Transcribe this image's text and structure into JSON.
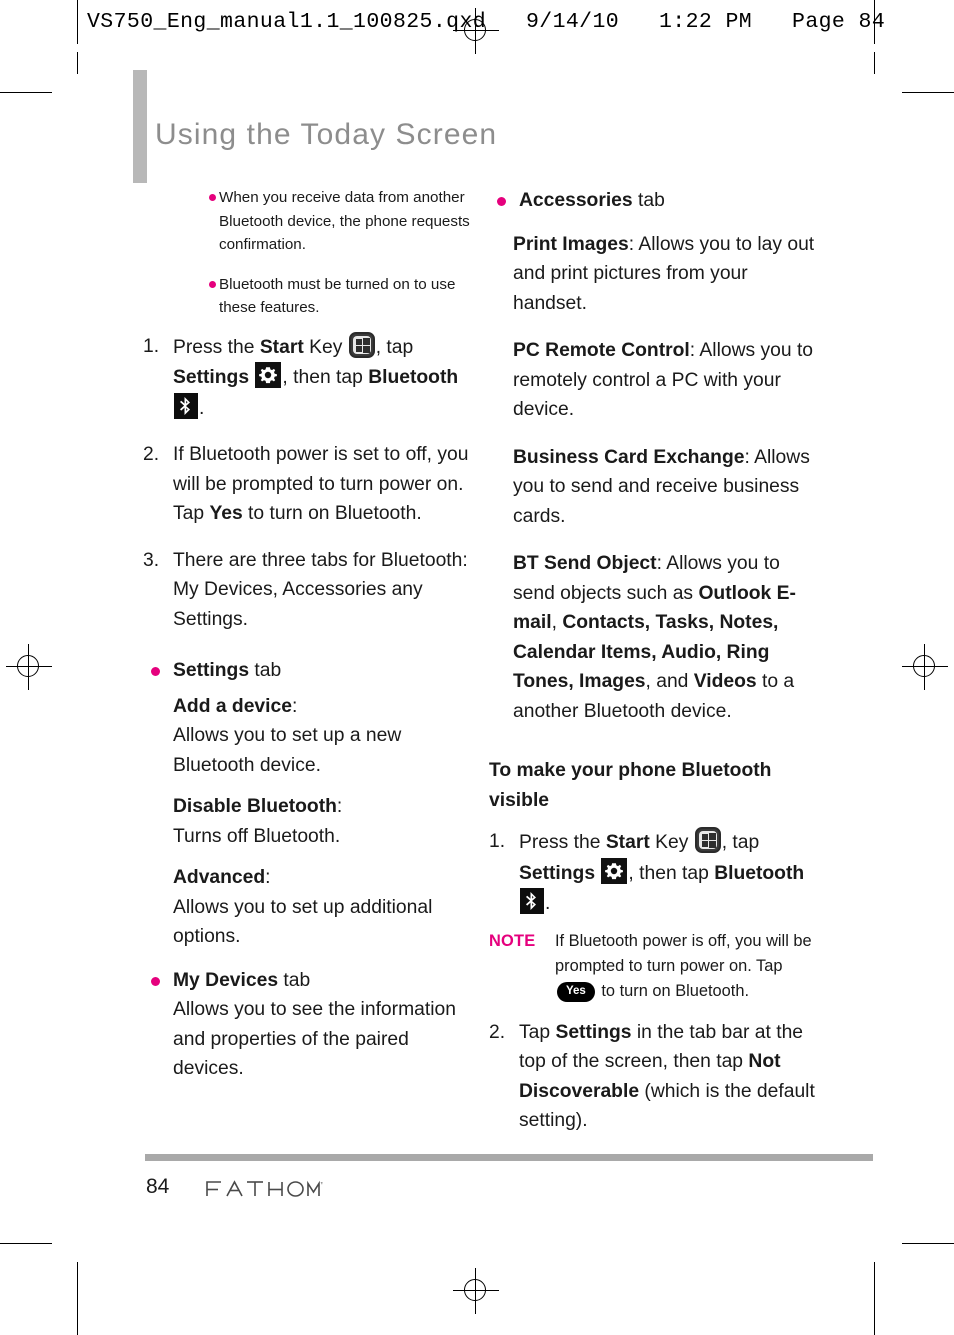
{
  "file_header": "VS750_Eng_manual1.1_100825.qxd   9/14/10   1:22 PM   Page 84",
  "page_title": "Using the Today Screen",
  "colors": {
    "accent_magenta": "#e5007d",
    "title_gray": "#8d8d8d",
    "rule_gray": "#a9a9a9"
  },
  "left_column": {
    "notes": [
      "When you receive data from another Bluetooth device, the phone requests confirmation.",
      "Bluetooth must be turned on to use these features."
    ],
    "step1": {
      "num": "1.",
      "t1": "Press the ",
      "b1": "Start",
      "t2": " Key ",
      "icon1": "start-key-icon",
      "t3": ", tap ",
      "b2": "Settings",
      "icon2": "settings-gear-icon",
      "t4": ", then tap ",
      "b3": "Bluetooth",
      "icon3": "bluetooth-icon",
      "t5": "."
    },
    "step2": {
      "num": "2.",
      "t1": "If Bluetooth power is set to off, you will be prompted to turn power on. Tap ",
      "b1": "Yes",
      "t2": " to turn on Bluetooth."
    },
    "step3": {
      "num": "3.",
      "t1": "There are three tabs for Bluetooth: My Devices, Accessories any Settings."
    },
    "settings_tab": {
      "label_bold": "Settings",
      "label_rest": " tab",
      "items": [
        {
          "term": "Add a device",
          "colon": ":",
          "desc": "Allows you to set up a new Bluetooth device."
        },
        {
          "term": "Disable Bluetooth",
          "colon": ":",
          "desc": "Turns off Bluetooth."
        },
        {
          "term": "Advanced",
          "colon": ":",
          "desc": "Allows you to set up additional options."
        }
      ]
    },
    "my_devices_tab": {
      "label_bold": "My Devices",
      "label_rest": " tab",
      "desc": "Allows you to see the information and properties of the paired devices."
    }
  },
  "right_column": {
    "accessories_tab": {
      "label_bold": "Accessories",
      "label_rest": " tab",
      "items": [
        {
          "term": "Print Images",
          "colon": ": ",
          "desc": "Allows you to lay out and print pictures from your handset."
        },
        {
          "term": "PC Remote Control",
          "colon": ": ",
          "desc": "Allows you to remotely control a PC with your device."
        },
        {
          "term": "Business Card Exchange",
          "colon": ": ",
          "desc": "Allows you to send and receive business cards."
        }
      ],
      "bt_send_object": {
        "term": "BT Send Object",
        "colon": ": ",
        "t1": "Allows you to send objects such as ",
        "b1": "Outlook E-mail",
        "t2": ", ",
        "b2": "Contacts, Tasks, Notes, Calendar Items, Audio, Ring Tones, Images",
        "t3": ", and ",
        "b3": "Videos",
        "t4": " to a another Bluetooth device."
      }
    },
    "visible_heading": "To make your phone Bluetooth visible",
    "step1": {
      "num": "1.",
      "t1": "Press the ",
      "b1": "Start",
      "t2": " Key ",
      "icon1": "start-key-icon",
      "t3": ", tap ",
      "b2": "Settings",
      "icon2": "settings-gear-icon",
      "t4": ", then tap ",
      "b3": "Bluetooth",
      "icon3": "bluetooth-icon",
      "t5": "."
    },
    "note": {
      "label": "NOTE",
      "t1": "If Bluetooth power is off, you will be prompted to turn power on. Tap ",
      "pill": "Yes",
      "t2": " to turn on Bluetooth."
    },
    "step2": {
      "num": "2.",
      "t1": "Tap ",
      "b1": "Settings",
      "t2": " in the tab bar at the top of the screen, then tap ",
      "b2": "Not Discoverable",
      "t3": " (which is the default setting)."
    }
  },
  "footer": {
    "page_number": "84",
    "logo_text": "FATHOM",
    "logo_tm": "™"
  }
}
